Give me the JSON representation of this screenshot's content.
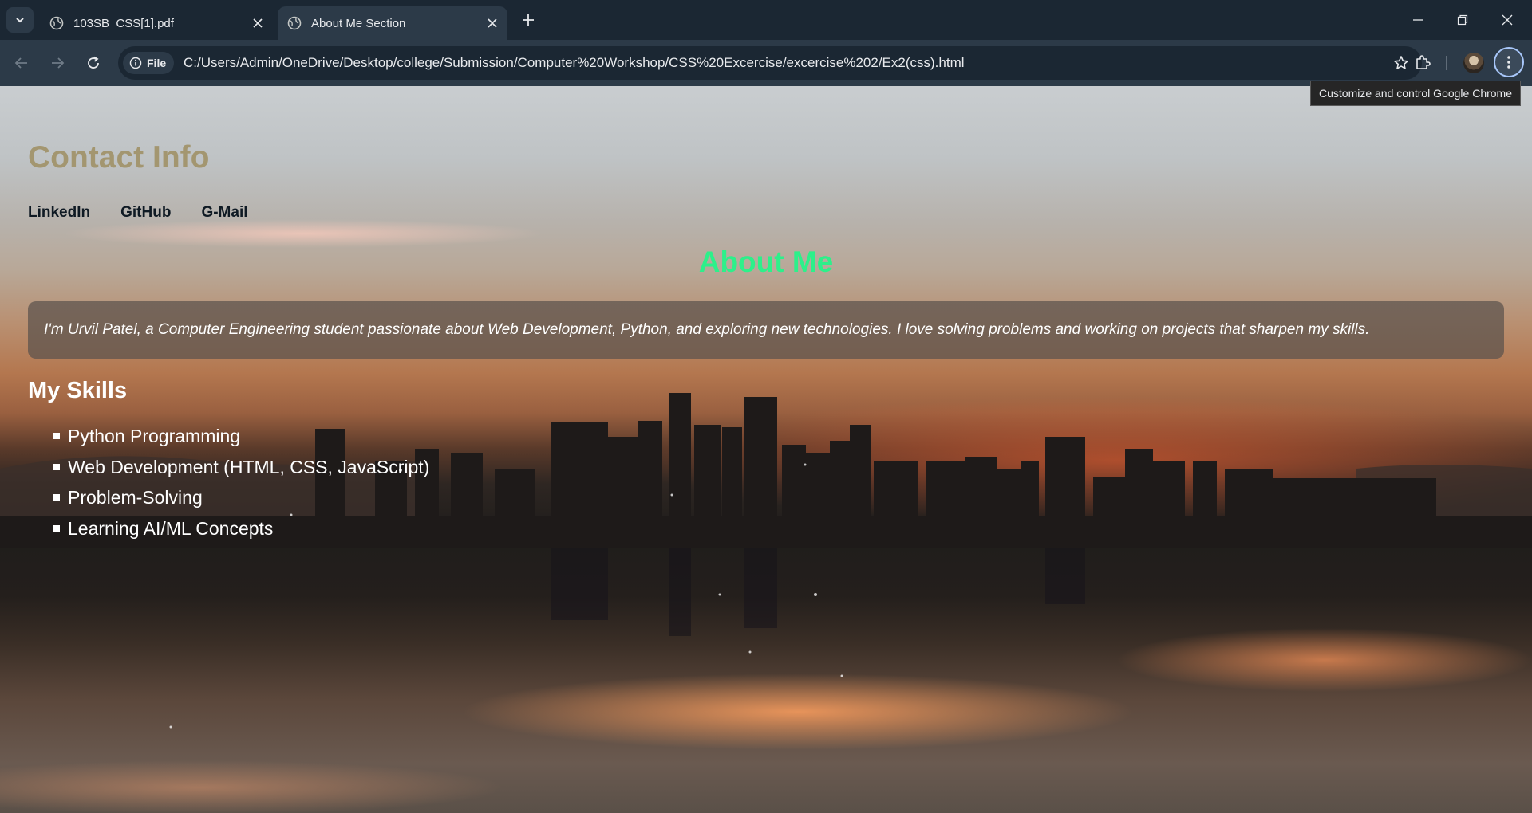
{
  "browser": {
    "tabs": [
      {
        "title": "103SB_CSS[1].pdf",
        "active": false
      },
      {
        "title": "About Me Section",
        "active": true
      }
    ],
    "omnibox": {
      "chip_label": "File",
      "url": "C:/Users/Admin/OneDrive/Desktop/college/Submission/Computer%20Workshop/CSS%20Excercise/excercise%202/Ex2(css).html"
    },
    "tooltip": "Customize and control Google Chrome",
    "icons": [
      "tab-search-icon",
      "globe-icon",
      "close-icon",
      "plus-icon",
      "minimize-icon",
      "restore-icon",
      "back-icon",
      "forward-icon",
      "reload-icon",
      "info-icon",
      "star-icon",
      "extensions-icon",
      "kebab-menu-icon"
    ],
    "colors": {
      "tabstrip": "#1b2733",
      "toolbar": "#2c3a48",
      "menu_ring": "#a8c7fa"
    }
  },
  "page": {
    "contact": {
      "title": "Contact Info",
      "links": [
        "LinkedIn",
        "GitHub",
        "G-Mail"
      ]
    },
    "about": {
      "title": "About Me",
      "text": "I'm Urvil Patel, a Computer Engineering student passionate about Web Development, Python, and exploring new technologies. I love solving problems and working on projects that sharpen my skills."
    },
    "skills": {
      "title": "My Skills",
      "items": [
        "Python Programming",
        "Web Development (HTML, CSS, JavaScript)",
        "Problem-Solving",
        "Learning AI/ML Concepts"
      ]
    },
    "colors": {
      "contact_title": "#a39670",
      "about_title": "#2df08a",
      "links": "#0f1a24",
      "text": "#ffffff"
    }
  }
}
